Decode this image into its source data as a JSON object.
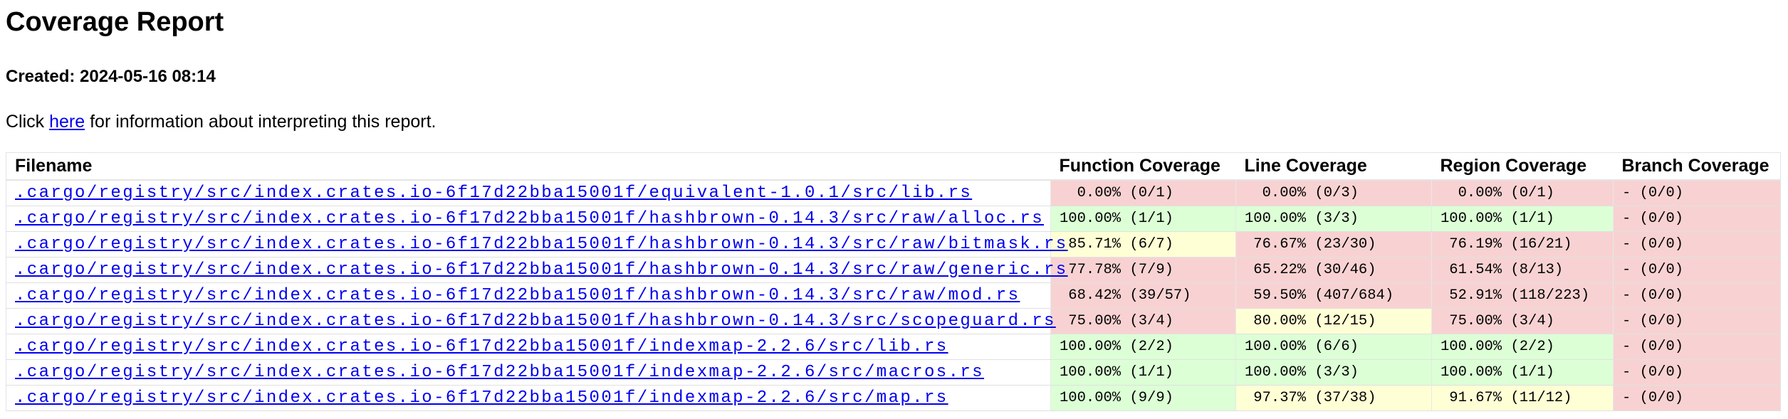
{
  "title": "Coverage Report",
  "created": "Created: 2024-05-16 08:14",
  "intro": {
    "before": "Click ",
    "link": "here",
    "after": " for information about interpreting this report."
  },
  "colors": {
    "red": "#f8d2d2",
    "yellow": "#ffffd6",
    "green": "#dcffd6",
    "link": "#0000ee"
  },
  "table": {
    "headers": [
      "Filename",
      "Function Coverage",
      "Line Coverage",
      "Region Coverage",
      "Branch Coverage"
    ],
    "rows": [
      {
        "file": ".cargo/registry/src/index.crates.io-6f17d22bba15001f/equivalent-1.0.1/src/lib.rs",
        "cells": [
          {
            "t": "  0.00% (0/1)",
            "c": "red"
          },
          {
            "t": "  0.00% (0/3)",
            "c": "red"
          },
          {
            "t": "  0.00% (0/1)",
            "c": "red"
          },
          {
            "t": "- (0/0)",
            "c": "red"
          }
        ]
      },
      {
        "file": ".cargo/registry/src/index.crates.io-6f17d22bba15001f/hashbrown-0.14.3/src/raw/alloc.rs",
        "cells": [
          {
            "t": "100.00% (1/1)",
            "c": "green"
          },
          {
            "t": "100.00% (3/3)",
            "c": "green"
          },
          {
            "t": "100.00% (1/1)",
            "c": "green"
          },
          {
            "t": "- (0/0)",
            "c": "red"
          }
        ]
      },
      {
        "file": ".cargo/registry/src/index.crates.io-6f17d22bba15001f/hashbrown-0.14.3/src/raw/bitmask.rs",
        "cells": [
          {
            "t": " 85.71% (6/7)",
            "c": "yellow"
          },
          {
            "t": " 76.67% (23/30)",
            "c": "red"
          },
          {
            "t": " 76.19% (16/21)",
            "c": "red"
          },
          {
            "t": "- (0/0)",
            "c": "red"
          }
        ]
      },
      {
        "file": ".cargo/registry/src/index.crates.io-6f17d22bba15001f/hashbrown-0.14.3/src/raw/generic.rs",
        "cells": [
          {
            "t": " 77.78% (7/9)",
            "c": "red"
          },
          {
            "t": " 65.22% (30/46)",
            "c": "red"
          },
          {
            "t": " 61.54% (8/13)",
            "c": "red"
          },
          {
            "t": "- (0/0)",
            "c": "red"
          }
        ]
      },
      {
        "file": ".cargo/registry/src/index.crates.io-6f17d22bba15001f/hashbrown-0.14.3/src/raw/mod.rs",
        "cells": [
          {
            "t": " 68.42% (39/57)",
            "c": "red"
          },
          {
            "t": " 59.50% (407/684)",
            "c": "red"
          },
          {
            "t": " 52.91% (118/223)",
            "c": "red"
          },
          {
            "t": "- (0/0)",
            "c": "red"
          }
        ]
      },
      {
        "file": ".cargo/registry/src/index.crates.io-6f17d22bba15001f/hashbrown-0.14.3/src/scopeguard.rs",
        "cells": [
          {
            "t": " 75.00% (3/4)",
            "c": "red"
          },
          {
            "t": " 80.00% (12/15)",
            "c": "yellow"
          },
          {
            "t": " 75.00% (3/4)",
            "c": "red"
          },
          {
            "t": "- (0/0)",
            "c": "red"
          }
        ]
      },
      {
        "file": ".cargo/registry/src/index.crates.io-6f17d22bba15001f/indexmap-2.2.6/src/lib.rs",
        "cells": [
          {
            "t": "100.00% (2/2)",
            "c": "green"
          },
          {
            "t": "100.00% (6/6)",
            "c": "green"
          },
          {
            "t": "100.00% (2/2)",
            "c": "green"
          },
          {
            "t": "- (0/0)",
            "c": "red"
          }
        ]
      },
      {
        "file": ".cargo/registry/src/index.crates.io-6f17d22bba15001f/indexmap-2.2.6/src/macros.rs",
        "cells": [
          {
            "t": "100.00% (1/1)",
            "c": "green"
          },
          {
            "t": "100.00% (3/3)",
            "c": "green"
          },
          {
            "t": "100.00% (1/1)",
            "c": "green"
          },
          {
            "t": "- (0/0)",
            "c": "red"
          }
        ]
      },
      {
        "file": ".cargo/registry/src/index.crates.io-6f17d22bba15001f/indexmap-2.2.6/src/map.rs",
        "cells": [
          {
            "t": "100.00% (9/9)",
            "c": "green"
          },
          {
            "t": " 97.37% (37/38)",
            "c": "yellow"
          },
          {
            "t": " 91.67% (11/12)",
            "c": "yellow"
          },
          {
            "t": "- (0/0)",
            "c": "red"
          }
        ]
      }
    ]
  }
}
